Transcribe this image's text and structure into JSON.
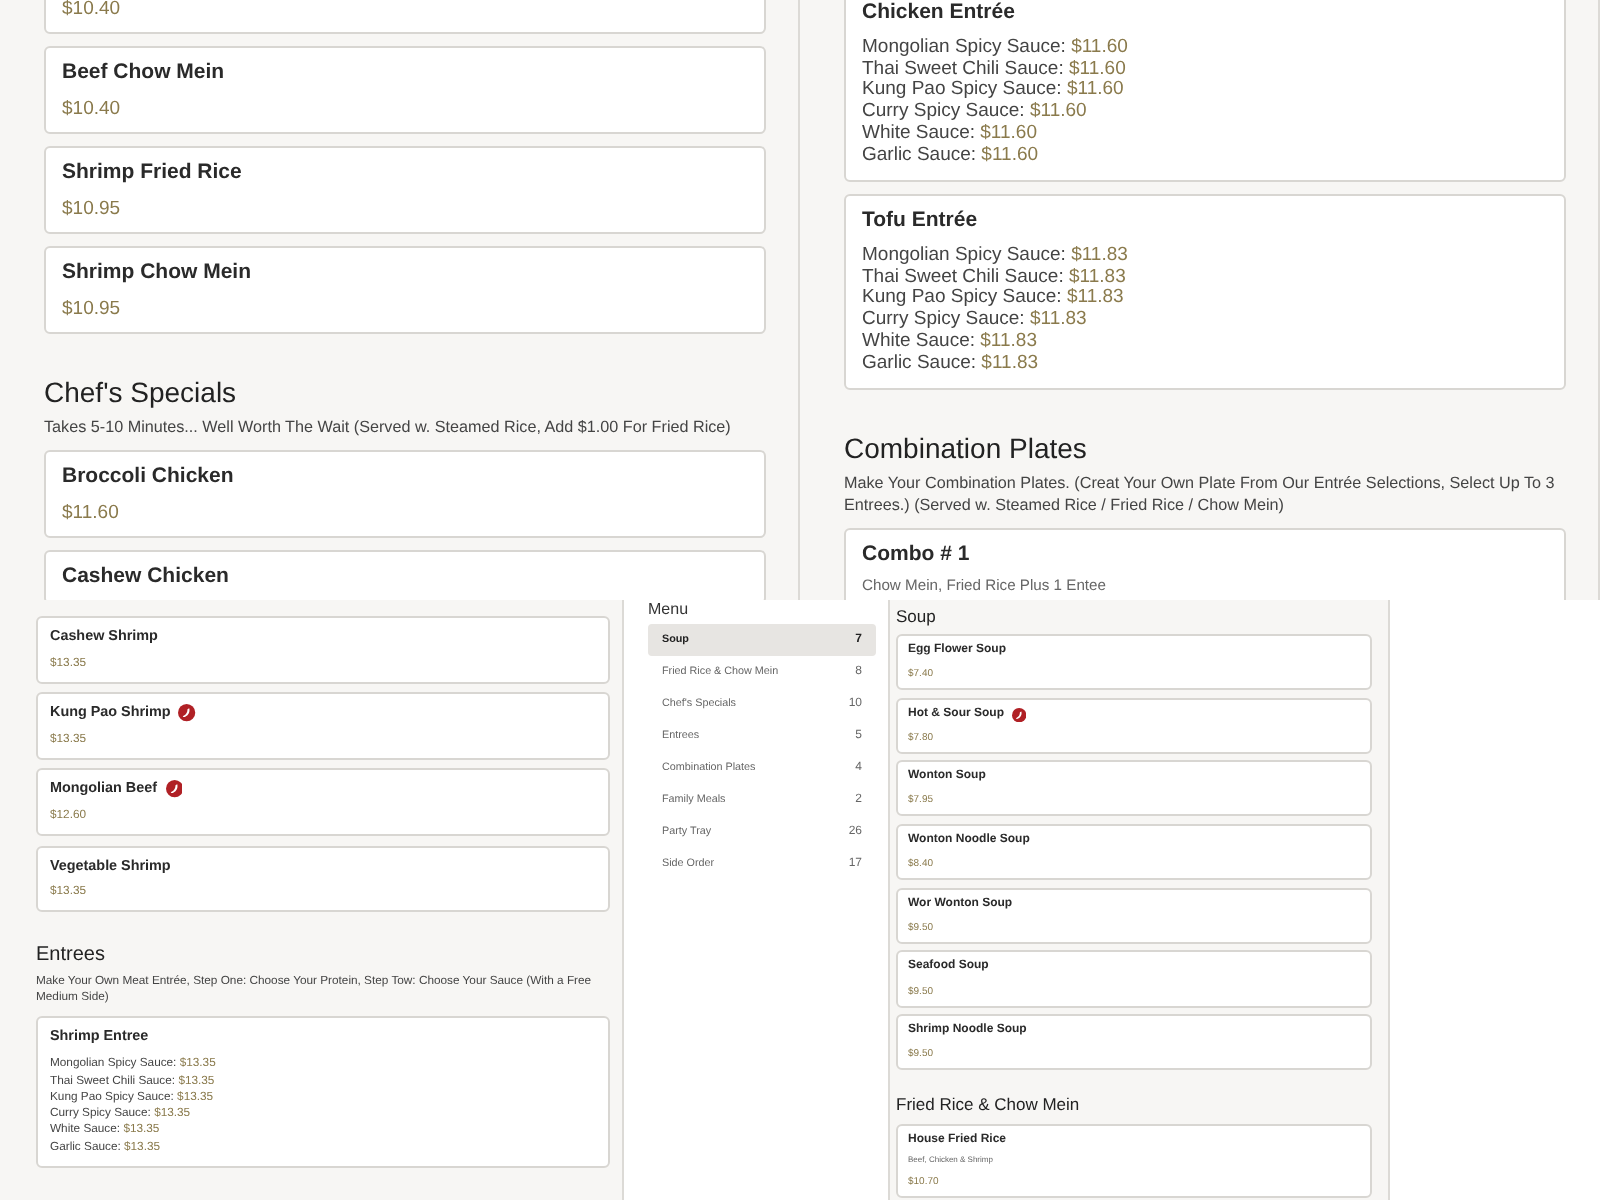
{
  "screens": [
    {
      "panels": [
        {
          "kind": "menu_list",
          "blocks": [
            {
              "kind": "card",
              "price": "$10.40"
            },
            {
              "kind": "card",
              "name": "Beef Chow Mein",
              "price": "$10.40",
              "spicy": false
            },
            {
              "kind": "card",
              "name": "Shrimp Fried Rice",
              "price": "$10.95",
              "spicy": false
            },
            {
              "kind": "card",
              "name": "Shrimp Chow Mein",
              "price": "$10.95",
              "spicy": false
            },
            {
              "kind": "section",
              "title": "Chef's Specials",
              "description": "Takes 5-10 Minutes... Well Worth The Wait (Served w. Steamed Rice, Add $1.00 For Fried Rice)"
            },
            {
              "kind": "card",
              "name": "Broccoli Chicken",
              "price": "$11.60",
              "spicy": false
            },
            {
              "kind": "card",
              "name": "Cashew Chicken",
              "spicy": false
            }
          ]
        },
        {
          "kind": "menu_list",
          "blocks": [
            {
              "kind": "sauce_card",
              "name": "Chicken Entrée",
              "lines": [
                {
                  "sauce": "Mongolian Spicy Sauce:",
                  "price": "$11.60"
                },
                {
                  "sauce": "Thai Sweet Chili Sauce:",
                  "price": "$11.60"
                },
                {
                  "sauce": "Kung Pao Spicy Sauce:",
                  "price": "$11.60"
                },
                {
                  "sauce": "Curry Spicy Sauce:",
                  "price": "$11.60"
                },
                {
                  "sauce": "White Sauce:",
                  "price": "$11.60"
                },
                {
                  "sauce": "Garlic Sauce:",
                  "price": "$11.60"
                }
              ]
            },
            {
              "kind": "sauce_card",
              "name": "Tofu Entrée",
              "lines": [
                {
                  "sauce": "Mongolian Spicy Sauce:",
                  "price": "$11.83"
                },
                {
                  "sauce": "Thai Sweet Chili Sauce:",
                  "price": "$11.83"
                },
                {
                  "sauce": "Kung Pao Spicy Sauce:",
                  "price": "$11.83"
                },
                {
                  "sauce": "Curry Spicy Sauce:",
                  "price": "$11.83"
                },
                {
                  "sauce": "White Sauce:",
                  "price": "$11.83"
                },
                {
                  "sauce": "Garlic Sauce:",
                  "price": "$11.83"
                }
              ]
            },
            {
              "kind": "section",
              "title": "Combination Plates",
              "description": "Make Your Combination Plates. (Creat Your Own Plate From Our Entrée Selections, Select Up To 3 Entrees.) (Served w. Steamed Rice / Fried Rice / Chow Mein)"
            },
            {
              "kind": "card",
              "name": "Combo # 1",
              "detail": "Chow Mein, Fried Rice Plus 1 Entee",
              "spicy": false
            }
          ]
        }
      ]
    },
    {
      "panels": [
        {
          "kind": "menu_list",
          "blocks": [
            {
              "kind": "card",
              "name": "Cashew Shrimp",
              "price": "$13.35",
              "spicy": false
            },
            {
              "kind": "card",
              "name": "Kung Pao Shrimp",
              "price": "$13.35",
              "spicy": true
            },
            {
              "kind": "card",
              "name": "Mongolian Beef",
              "price": "$12.60",
              "spicy": true
            },
            {
              "kind": "card",
              "name": "Vegetable Shrimp",
              "price": "$13.35",
              "spicy": false
            },
            {
              "kind": "section",
              "title": "Entrees",
              "description": "Make Your Own Meat Entrée, Step One: Choose Your Protein, Step Tow: Choose Your Sauce (With a Free Medium Side)"
            },
            {
              "kind": "sauce_card",
              "name": "Shrimp Entree",
              "lines": [
                {
                  "sauce": "Mongolian Spicy Sauce:",
                  "price": "$13.35"
                },
                {
                  "sauce": "Thai Sweet Chili Sauce:",
                  "price": "$13.35"
                },
                {
                  "sauce": "Kung Pao Spicy Sauce:",
                  "price": "$13.35"
                },
                {
                  "sauce": "Curry Spicy Sauce:",
                  "price": "$13.35"
                },
                {
                  "sauce": "White Sauce:",
                  "price": "$13.35"
                },
                {
                  "sauce": "Garlic Sauce:",
                  "price": "$13.35"
                }
              ]
            }
          ]
        },
        {
          "kind": "category_nav",
          "title": "Menu",
          "items": [
            {
              "label": "Soup",
              "count": "7",
              "selected": true
            },
            {
              "label": "Fried Rice & Chow Mein",
              "count": "8",
              "selected": false
            },
            {
              "label": "Chef's Specials",
              "count": "10",
              "selected": false
            },
            {
              "label": "Entrees",
              "count": "5",
              "selected": false
            },
            {
              "label": "Combination Plates",
              "count": "4",
              "selected": false
            },
            {
              "label": "Family Meals",
              "count": "2",
              "selected": false
            },
            {
              "label": "Party Tray",
              "count": "26",
              "selected": false
            },
            {
              "label": "Side Order",
              "count": "17",
              "selected": false
            }
          ]
        },
        {
          "kind": "menu_list",
          "blocks": [
            {
              "kind": "section",
              "title": "Soup"
            },
            {
              "kind": "card",
              "name": "Egg Flower Soup",
              "price": "$7.40",
              "spicy": false
            },
            {
              "kind": "card",
              "name": "Hot & Sour Soup",
              "price": "$7.80",
              "spicy": true
            },
            {
              "kind": "card",
              "name": "Wonton Soup",
              "price": "$7.95",
              "spicy": false
            },
            {
              "kind": "card",
              "name": "Wonton Noodle Soup",
              "price": "$8.40",
              "spicy": false
            },
            {
              "kind": "card",
              "name": "Wor Wonton Soup",
              "price": "$9.50",
              "spicy": false
            },
            {
              "kind": "card",
              "name": "Seafood Soup",
              "price": "$9.50",
              "spicy": false
            },
            {
              "kind": "card",
              "name": "Shrimp Noodle Soup",
              "price": "$9.50",
              "spicy": false
            },
            {
              "kind": "section",
              "title": "Fried Rice & Chow Mein"
            },
            {
              "kind": "card",
              "name": "House Fried Rice",
              "detail": "Beef, Chicken & Shrimp",
              "price": "$10.70",
              "spicy": false
            }
          ]
        }
      ]
    }
  ]
}
